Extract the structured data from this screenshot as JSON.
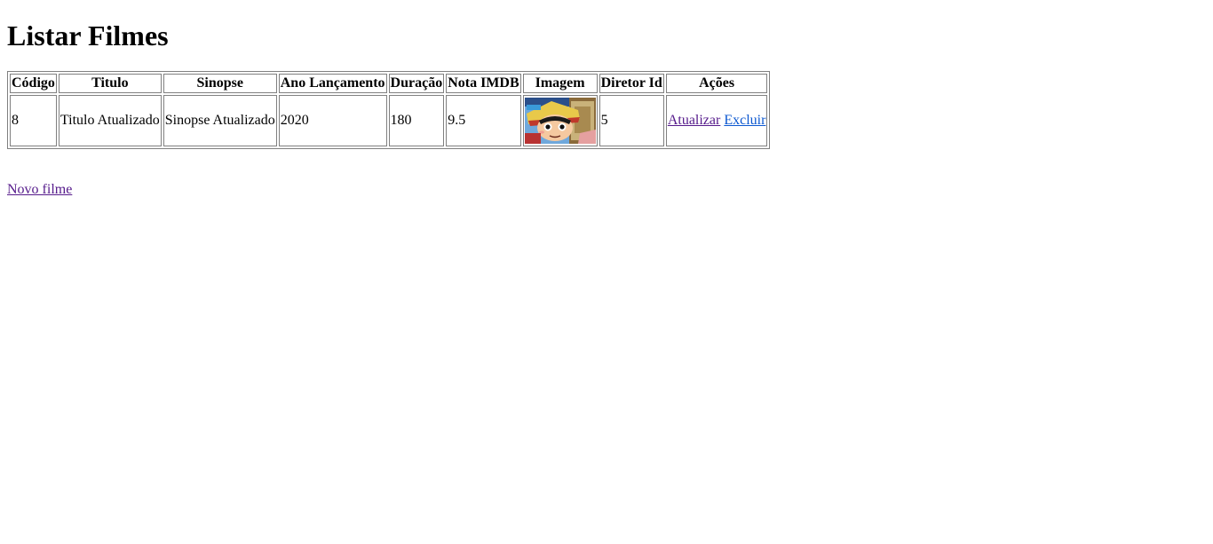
{
  "page": {
    "title": "Listar Filmes"
  },
  "table": {
    "headers": [
      "Código",
      "Titulo",
      "Sinopse",
      "Ano Lançamento",
      "Duração",
      "Nota IMDB",
      "Imagem",
      "Diretor Id",
      "Ações"
    ],
    "rows": [
      {
        "codigo": "8",
        "titulo": "Titulo Atualizado",
        "sinopse": "Sinopse Atualizado",
        "ano": "2020",
        "duracao": "180",
        "nota": "9.5",
        "imagem_icon": "anime-poster-thumbnail",
        "diretor_id": "5",
        "update_label": "Atualizar",
        "delete_label": "Excluir"
      }
    ]
  },
  "footer": {
    "new_label": "Novo filme"
  },
  "colors": {
    "visited_link": "#551a8b",
    "link": "#0b57d0"
  }
}
